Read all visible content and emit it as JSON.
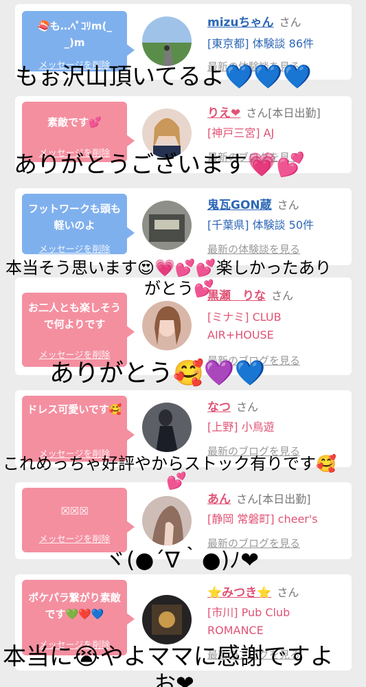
{
  "cards": [
    {
      "message": "🍣も…ﾍﾟｺﾘm(_ _)m",
      "delete": "メッセージを削除",
      "name": "mizuちゃん",
      "san": "さん",
      "details": [
        "[東京都] 体験談 86件"
      ],
      "latest": "最新の体験談を見る"
    },
    {
      "message": "素敵です💕",
      "delete": "メッセージを削除",
      "name": "りえ❤",
      "san": "さん[本日出勤]",
      "details": [
        "[神戸三宮] AJ"
      ],
      "latest": "最新のブログを見る"
    },
    {
      "message": "フットワークも頭も軽いのよ",
      "delete": "メッセージを削除",
      "name": "鬼瓦GON蔵",
      "san": "さん",
      "details": [
        "[千葉県] 体験談 50件"
      ],
      "latest": "最新の体験談を見る"
    },
    {
      "message": "お二人とも楽しそうで何よりです",
      "delete": "メッセージを削除",
      "name": "黒瀬　りな",
      "san": "さん",
      "details": [
        "[ミナミ] CLUB",
        "AIR+HOUSE"
      ],
      "latest": "最新のブログを見る"
    },
    {
      "message": "ドレス可愛いです🥰",
      "delete": "メッセージを削除",
      "name": "なつ",
      "san": "さん",
      "details": [
        "[上野] 小鳥遊"
      ],
      "latest": "最新のブログを見る"
    },
    {
      "message": "☒☒☒",
      "delete": "メッセージを削除",
      "name": "あん",
      "san": "さん[本日出勤]",
      "details": [
        "[静岡 常磐町] cheer's"
      ],
      "latest": "最新のブログを見る"
    },
    {
      "message": "ポケパラ繋がり素敵です💚❤️💙",
      "delete": "メッセージを削除",
      "name": "⭐みつき⭐",
      "san": "さん",
      "details": [
        "[市川] Pub Club",
        "ROMANCE"
      ],
      "latest": "最新のブログを見る"
    }
  ],
  "captions": [
    "もぉ沢山頂いてるよ💙💙💙",
    "ありがとうございます💗💕",
    "本当そう思います😍💗💕💕楽しかったあり",
    "がとう💕",
    "ありがとう🥰💜💙",
    "これめっちゃ好評やからストック有りです🥰",
    "💕",
    "ヾ(●´∇｀●)ﾉ❤",
    "本当に😭やよママに感謝ですよ",
    "お❤"
  ]
}
